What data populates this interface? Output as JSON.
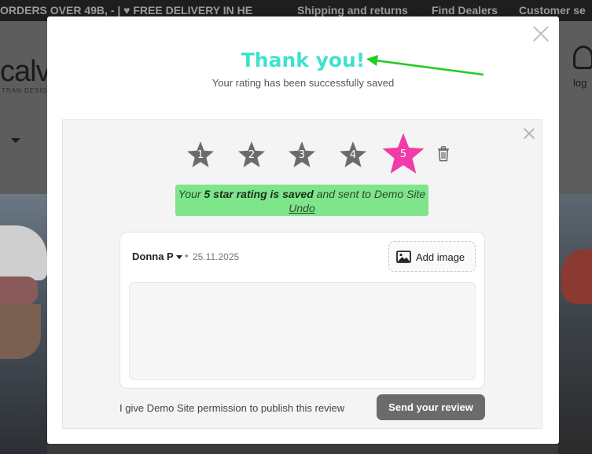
{
  "background": {
    "promo_text": "ORDERS OVER 49Β, - | ♥ FREE DELIVERY IN HE",
    "nav_links": [
      "Shipping and returns",
      "Find Dealers",
      "Customer se"
    ],
    "logo_text": "calv",
    "logo_sub": "TRAN DESIG",
    "account_label": "log"
  },
  "modal": {
    "title": "Thank you!",
    "subtitle": "Your rating has been successfully saved"
  },
  "rating": {
    "stars": [
      "1",
      "2",
      "3",
      "4",
      "5"
    ],
    "selected": 5,
    "colors": {
      "inactive": "#6b6b6b",
      "selected": "#f23aa8"
    }
  },
  "saved_banner": {
    "part1": "Your ",
    "bold": "5 star rating is saved",
    "part2": " and sent to Demo Site ",
    "undo": "Undo"
  },
  "review": {
    "reviewer": "Donna P",
    "separator": "•",
    "date": "25.11.2025",
    "add_image_label": "Add image",
    "text_value": ""
  },
  "footer": {
    "permission_text": "I give Demo Site permission to publish this review",
    "send_label": "Send your review"
  },
  "colors": {
    "accent_title": "#3ee3cf",
    "banner_bg": "#7ee58a",
    "annotation_arrow": "#22cc22",
    "button_bg": "#6b6b6b"
  }
}
